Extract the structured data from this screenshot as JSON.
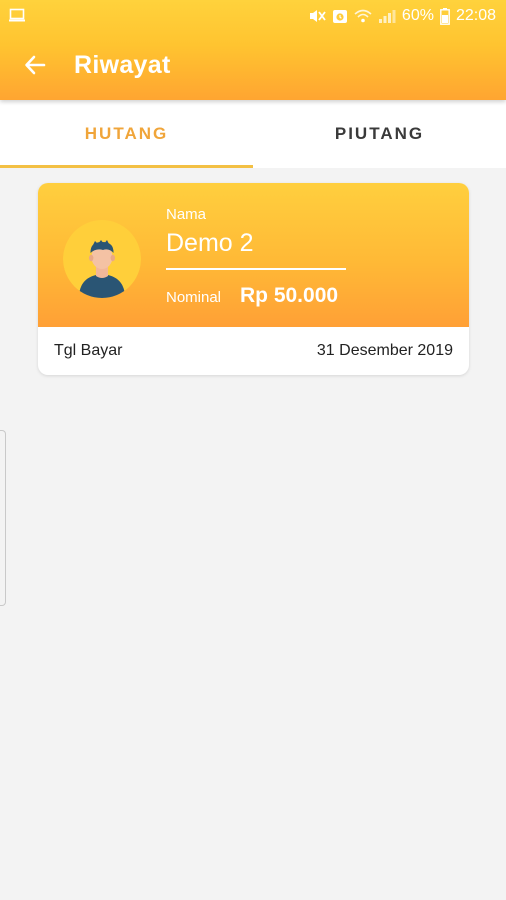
{
  "status_bar": {
    "battery_percent": "60%",
    "time": "22:08",
    "icons": [
      "screen-icon",
      "mute-icon",
      "alarm-icon",
      "wifi-icon",
      "signal-icon",
      "battery-icon"
    ]
  },
  "app_bar": {
    "back_icon": "arrow-left-icon",
    "title": "Riwayat"
  },
  "tabs": [
    {
      "label": "HUTANG",
      "active": true
    },
    {
      "label": "PIUTANG",
      "active": false
    }
  ],
  "records": [
    {
      "name_label": "Nama",
      "name": "Demo 2",
      "nominal_label": "Nominal",
      "nominal_value": "Rp 50.000",
      "date_label": "Tgl Bayar",
      "date_value": "31 Desember 2019",
      "avatar_icon": "person-avatar-icon"
    }
  ],
  "colors": {
    "accent": "#f0a53a",
    "header_top": "#ffd23c",
    "header_bottom": "#ffa531",
    "background": "#f3f3f3"
  }
}
